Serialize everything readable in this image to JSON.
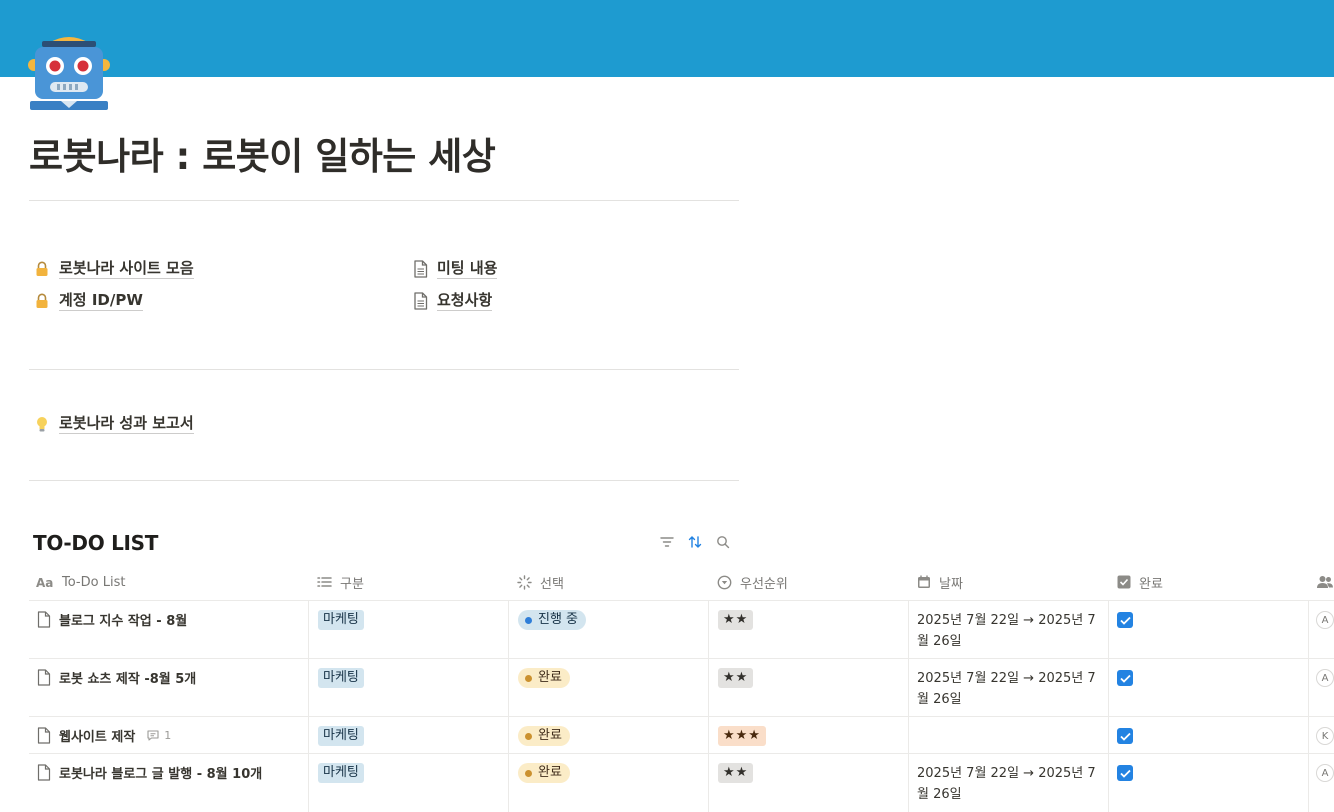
{
  "page": {
    "title": "로봇나라 : 로봇이 일하는 세상",
    "icon": "robot-face-icon",
    "cover_color": "#1e9bd0"
  },
  "links": {
    "col1": [
      {
        "label": "로봇나라 사이트 모음",
        "icon": "lock-icon"
      },
      {
        "label": "계정 ID/PW",
        "icon": "lock-icon"
      }
    ],
    "col2": [
      {
        "label": "미팅 내용",
        "icon": "page-icon"
      },
      {
        "label": "요청사항",
        "icon": "page-icon"
      }
    ],
    "report": {
      "label": "로봇나라 성과 보고서",
      "icon": "lightbulb-icon"
    }
  },
  "database": {
    "title": "TO-DO LIST",
    "tools": [
      "filter-icon",
      "sort-icon",
      "search-icon"
    ],
    "columns": [
      {
        "label": "To-Do List",
        "icon": "title-aa-icon"
      },
      {
        "label": "구분",
        "icon": "list-icon"
      },
      {
        "label": "선택",
        "icon": "status-icon"
      },
      {
        "label": "우선순위",
        "icon": "select-icon"
      },
      {
        "label": "날짜",
        "icon": "calendar-icon"
      },
      {
        "label": "완료",
        "icon": "checkbox-icon"
      },
      {
        "label": "",
        "icon": "people-icon"
      }
    ],
    "rows": [
      {
        "name": "블로그 지수 작업 - 8월",
        "comments": "",
        "category": "마케팅",
        "status": "진행 중",
        "status_color": "blue",
        "priority": "★★",
        "priority_color": "gray",
        "date_line1": "2025년 7월 22일 → 2025년 7",
        "date_line2": "월 26일",
        "done": true,
        "person": "A"
      },
      {
        "name": "로봇 쇼츠 제작 -8월 5개",
        "comments": "",
        "category": "마케팅",
        "status": "완료",
        "status_color": "yellow",
        "priority": "★★",
        "priority_color": "gray",
        "date_line1": "2025년 7월 22일 → 2025년 7",
        "date_line2": "월 26일",
        "done": true,
        "person": "A"
      },
      {
        "name": "웹사이트 제작",
        "comments": "1",
        "category": "마케팅",
        "status": "완료",
        "status_color": "yellow",
        "priority": "★★★",
        "priority_color": "orange",
        "date_line1": "",
        "date_line2": "",
        "done": true,
        "person": "K"
      },
      {
        "name": "로봇나라 블로그 글 발행 - 8월 10개",
        "comments": "",
        "category": "마케팅",
        "status": "완료",
        "status_color": "yellow",
        "priority": "★★",
        "priority_color": "gray",
        "date_line1": "2025년 7월 22일 → 2025년 7",
        "date_line2": "월 26일",
        "done": true,
        "person": "A"
      }
    ]
  }
}
